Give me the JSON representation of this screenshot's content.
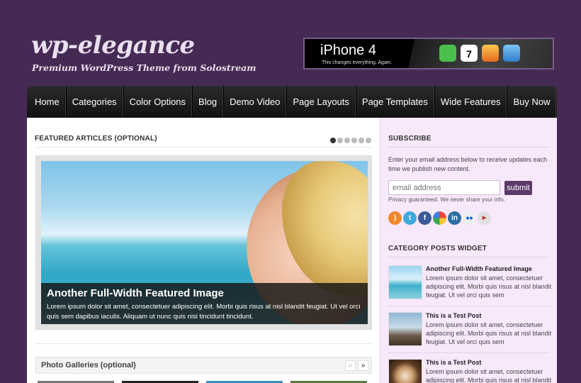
{
  "site": {
    "title": "wp-elegance",
    "tagline": "Premium WordPress Theme from Solostream"
  },
  "ad": {
    "title": "iPhone 4",
    "subtitle": "This changes everything. Again.",
    "calendar_day": "7"
  },
  "nav": {
    "items": [
      "Home",
      "Categories",
      "Color Options",
      "Blog",
      "Demo Video",
      "Page Layouts",
      "Page Templates",
      "Wide Features",
      "Buy Now"
    ]
  },
  "featured": {
    "section_title": "FEATURED ARTICLES (OPTIONAL)",
    "slide_count": 6,
    "active_slide": 1,
    "caption_title": "Another Full-Width Featured Image",
    "caption_text": "Lorem ipsum dolor sit amet, consectetuer adipiscing elit. Morbi quis risus at nisl blandit feugiat. Ut vel orci quis sem dapibus iaculis. Aliquam ut nunc quis nisi tincidunt tincidunt."
  },
  "galleries": {
    "title": "Photo Galleries (optional)",
    "prev_label": "«",
    "next_label": "»"
  },
  "subscribe": {
    "title": "SUBSCRIBE",
    "description": "Enter your email address below to receive updates each time we publish new content.",
    "email_placeholder": "email address",
    "submit_label": "submit",
    "privacy_text": "Privacy guaranteed. We never share your info.",
    "social_icons": [
      "rss-icon",
      "twitter-icon",
      "facebook-icon",
      "google-icon",
      "linkedin-icon",
      "flickr-icon",
      "youtube-icon"
    ]
  },
  "category_widget": {
    "title": "CATEGORY POSTS WIDGET",
    "posts": [
      {
        "title": "Another Full-Width Featured Image",
        "excerpt": "Lorem ipsum dolor sit amet, consectetuer adipiscing elit. Morbi quis risus at nisl blandit feugiat. Ut vel orci quis sem"
      },
      {
        "title": "This is a Test Post",
        "excerpt": "Lorem ipsum dolor sit amet, consectetuer adipiscing elit. Morbi quis risus at nisl blandit feugiat. Ut vel orci quis sem"
      },
      {
        "title": "This is a Test Post",
        "excerpt": "Lorem ipsum dolor sit amet, consectetuer adipiscing elit. Morbi quis risus at nisl blandit feugiat. Ut vel orci quis sem"
      }
    ]
  },
  "colors": {
    "page_bg": "#452a54",
    "sidebar_bg": "#f8e8fc",
    "accent": "#5b3a6a"
  }
}
